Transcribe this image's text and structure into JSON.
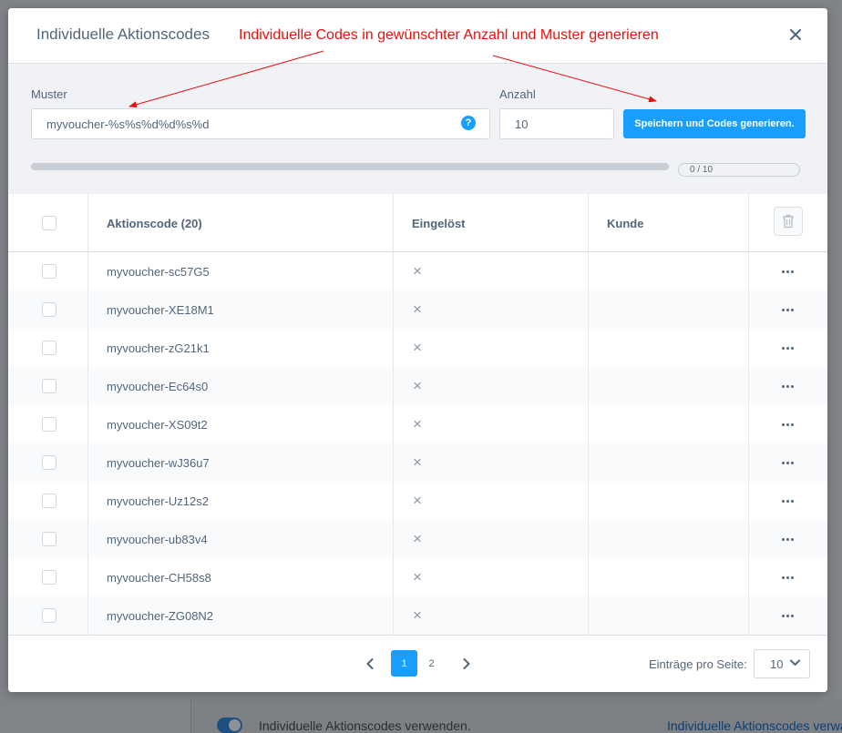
{
  "background": {
    "toggle_label": "Individuelle Aktionscodes verwenden.",
    "link_text": "Individuelle Aktionscodes verwal"
  },
  "modal": {
    "title": "Individuelle Aktionscodes",
    "annotation": "Individuelle Codes in gewünschter Anzahl und Muster generieren",
    "close_icon": "close-icon"
  },
  "form": {
    "pattern_label": "Muster",
    "pattern_value": "myvoucher-%s%s%d%d%s%d",
    "count_label": "Anzahl",
    "count_value": "10",
    "generate_button": "Speichern und Codes generieren.",
    "progress_text": "0 / 10",
    "progress_fraction": 0
  },
  "table": {
    "headers": {
      "code": "Aktionscode (20)",
      "redeemed": "Eingelöst",
      "customer": "Kunde"
    },
    "rows": [
      {
        "code": "myvoucher-sc57G5",
        "redeemed": "×",
        "customer": ""
      },
      {
        "code": "myvoucher-XE18M1",
        "redeemed": "×",
        "customer": ""
      },
      {
        "code": "myvoucher-zG21k1",
        "redeemed": "×",
        "customer": ""
      },
      {
        "code": "myvoucher-Ec64s0",
        "redeemed": "×",
        "customer": ""
      },
      {
        "code": "myvoucher-XS09t2",
        "redeemed": "×",
        "customer": ""
      },
      {
        "code": "myvoucher-wJ36u7",
        "redeemed": "×",
        "customer": ""
      },
      {
        "code": "myvoucher-Uz12s2",
        "redeemed": "×",
        "customer": ""
      },
      {
        "code": "myvoucher-ub83v4",
        "redeemed": "×",
        "customer": ""
      },
      {
        "code": "myvoucher-CH58s8",
        "redeemed": "×",
        "customer": ""
      },
      {
        "code": "myvoucher-ZG08N2",
        "redeemed": "×",
        "customer": ""
      }
    ]
  },
  "pagination": {
    "pages": [
      "1",
      "2"
    ],
    "active_page": "1",
    "per_page_label": "Einträge pro Seite:",
    "per_page_value": "10"
  },
  "colors": {
    "accent": "#189eff",
    "annotation": "#e8100f",
    "text": "#52667a"
  }
}
